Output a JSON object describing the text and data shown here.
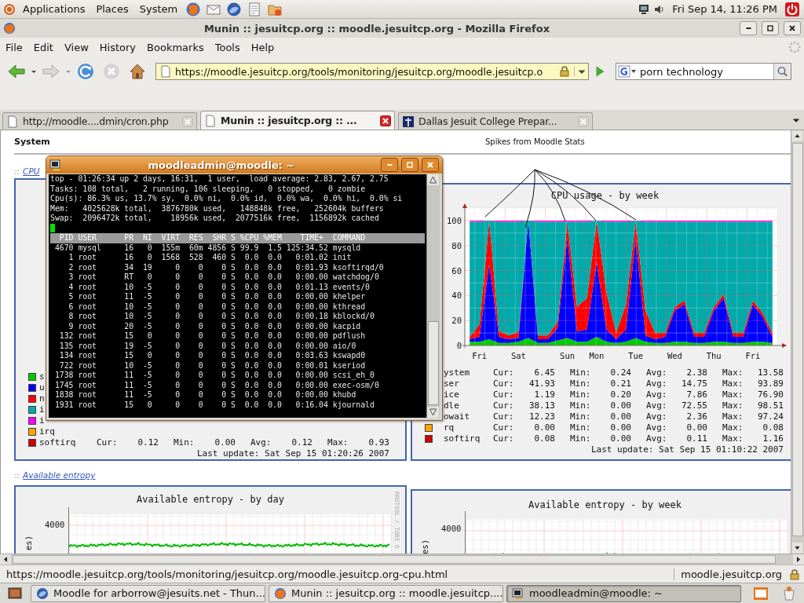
{
  "top_panel": {
    "menus": [
      "Applications",
      "Places",
      "System"
    ],
    "clock": "Fri Sep 14, 11:26 PM"
  },
  "window": {
    "title": "Munin :: jesuitcp.org :: moodle.jesuitcp.org - Mozilla Firefox"
  },
  "menu_bar": [
    "File",
    "Edit",
    "View",
    "History",
    "Bookmarks",
    "Tools",
    "Help"
  ],
  "address_bar": {
    "value": "https://moodle.jesuitcp.org/tools/monitoring/jesuitcp.org/moodle.jesuitcp.o"
  },
  "search": {
    "value": "porn technology"
  },
  "tabs": [
    {
      "label": "http://moodle....dmin/cron.php",
      "selected": false
    },
    {
      "label": "Munin :: jesuitcp.org :: ...",
      "selected": true
    },
    {
      "label": "Dallas Jesuit College Prepar...",
      "selected": false
    }
  ],
  "page": {
    "section_title": "System",
    "annotation": "Spikes from Moodle Stats",
    "cpu_link": {
      "prefix": "::",
      "label": "CPU"
    },
    "cpu_day_panel": {
      "legend": [
        {
          "label": "s",
          "color": "#00cc00"
        },
        {
          "label": "u",
          "color": "#0000ff"
        },
        {
          "label": "n",
          "color": "#ff0000"
        },
        {
          "label": "i",
          "color": "#00aaaa"
        },
        {
          "label": "i",
          "color": "#ff00ff"
        },
        {
          "label": "irq",
          "color": "#ffa500"
        },
        {
          "label": "softirq",
          "color": "#cc0000",
          "stats": [
            {
              "key": "Cur:",
              "value": "0.12"
            },
            {
              "key": "Min:",
              "value": "0.00"
            },
            {
              "key": "Avg:",
              "value": "0.12"
            },
            {
              "key": "Max:",
              "value": "0.93"
            }
          ]
        }
      ],
      "last_update": "Last update: Sat Sep 15 01:20:26 2007"
    },
    "cpu_week_panel": {
      "chart_data": {
        "type": "area",
        "title": "CPU usage - by week",
        "categories": [
          null,
          "Fri",
          null,
          null,
          null,
          "Sat",
          null,
          null,
          null,
          null,
          "Sun",
          null,
          null,
          "Mon",
          null,
          null,
          null,
          "Tue",
          null,
          null,
          null,
          "Wed",
          null,
          null,
          null,
          "Thu",
          null,
          null,
          null,
          "Fri",
          null,
          null
        ],
        "yticks": [
          0,
          20,
          40,
          60,
          80,
          100
        ],
        "ylim": [
          0,
          110
        ],
        "grid": true,
        "stacked": true,
        "series": [
          {
            "color": "#00cc00",
            "values": [
              3,
              3,
              5,
              2,
              2,
              3,
              6,
              2,
              2,
              4,
              6,
              3,
              3,
              7,
              3,
              2,
              3,
              6,
              3,
              2,
              2,
              3,
              3,
              2,
              2,
              3,
              3,
              2,
              2,
              3,
              3,
              2
            ]
          },
          {
            "color": "#0000ff",
            "values": [
              2,
              4,
              60,
              5,
              3,
              3,
              94,
              3,
              3,
              10,
              80,
              8,
              10,
              60,
              10,
              3,
              10,
              80,
              5,
              3,
              5,
              25,
              30,
              5,
              5,
              25,
              35,
              5,
              5,
              30,
              20,
              5
            ]
          },
          {
            "color": "#ff0000",
            "values": [
              2,
              10,
              35,
              5,
              3,
              5,
              0,
              3,
              3,
              5,
              13,
              20,
              25,
              33,
              30,
              5,
              20,
              14,
              20,
              5,
              3,
              3,
              3,
              3,
              3,
              3,
              3,
              3,
              3,
              3,
              3,
              3
            ]
          },
          {
            "color": "#00aaaa",
            "values": [
              92,
              82,
              0,
              87,
              91,
              88,
              0,
              91,
              91,
              80,
              0,
              68,
              61,
              0,
              56,
              89,
              66,
              0,
              71,
              89,
              89,
              68,
              63,
              89,
              89,
              68,
              58,
              89,
              89,
              63,
              73,
              89
            ]
          },
          {
            "color": "#ff00ff",
            "values": [
              1,
              1,
              0,
              1,
              1,
              1,
              0,
              1,
              1,
              1,
              1,
              1,
              1,
              0,
              1,
              1,
              1,
              0,
              1,
              1,
              1,
              1,
              1,
              1,
              1,
              1,
              1,
              1,
              1,
              1,
              1,
              1
            ]
          }
        ]
      },
      "legend": [
        {
          "label": "ystem",
          "stats": [
            {
              "key": "Cur:",
              "value": "6.45"
            },
            {
              "key": "Min:",
              "value": "0.24"
            },
            {
              "key": "Avg:",
              "value": "2.38"
            },
            {
              "key": "Max:",
              "value": "13.58"
            }
          ]
        },
        {
          "label": "ser",
          "stats": [
            {
              "key": "Cur:",
              "value": "41.93"
            },
            {
              "key": "Min:",
              "value": "0.21"
            },
            {
              "key": "Avg:",
              "value": "14.75"
            },
            {
              "key": "Max:",
              "value": "93.89"
            }
          ]
        },
        {
          "label": "ice",
          "stats": [
            {
              "key": "Cur:",
              "value": "1.19"
            },
            {
              "key": "Min:",
              "value": "0.20"
            },
            {
              "key": "Avg:",
              "value": "7.86"
            },
            {
              "key": "Max:",
              "value": "76.90"
            }
          ]
        },
        {
          "label": "dle",
          "stats": [
            {
              "key": "Cur:",
              "value": "38.13"
            },
            {
              "key": "Min:",
              "value": "0.00"
            },
            {
              "key": "Avg:",
              "value": "72.55"
            },
            {
              "key": "Max:",
              "value": "98.51"
            }
          ]
        },
        {
          "label": "owait",
          "stats": [
            {
              "key": "Cur:",
              "value": "12.23"
            },
            {
              "key": "Min:",
              "value": "0.00"
            },
            {
              "key": "Avg:",
              "value": "2.36"
            },
            {
              "key": "Max:",
              "value": "97.24"
            }
          ]
        },
        {
          "label": "rq",
          "color": "#ffa500",
          "stats": [
            {
              "key": "Cur:",
              "value": "0.00"
            },
            {
              "key": "Min:",
              "value": "0.00"
            },
            {
              "key": "Avg:",
              "value": "0.00"
            },
            {
              "key": "Max:",
              "value": "0.08"
            }
          ]
        },
        {
          "label": "softirq",
          "color": "#cc0000",
          "stats": [
            {
              "key": "Cur:",
              "value": "0.08"
            },
            {
              "key": "Min:",
              "value": "0.00"
            },
            {
              "key": "Avg:",
              "value": "0.11"
            },
            {
              "key": "Max:",
              "value": "1.16"
            }
          ]
        }
      ],
      "last_update": "Last update: Sat Sep 15 01:10:22 2007"
    },
    "entropy_link": {
      "prefix": "::",
      "label": "Available entropy"
    },
    "entropy_panels": [
      {
        "title": "Available entropy - by day",
        "ytick": "4000",
        "ylabel": "es)",
        "side_text": "RRDTOOL / TOBI O"
      },
      {
        "title": "Available entropy - by week",
        "ytick": "4000",
        "ylabel": "es)"
      }
    ]
  },
  "status_bar": {
    "url": "https://moodle.jesuitcp.org/tools/monitoring/jesuitcp.org/moodle.jesuitcp.org-cpu.html",
    "host": "moodle.jesuitcp.org"
  },
  "taskbar": [
    {
      "label": "Moodle for arborrow@jesuits.net - Thun...",
      "selected": false
    },
    {
      "label": "Munin :: jesuitcp.org :: moodle.jesuitcp....",
      "selected": false
    },
    {
      "label": "moodleadmin@moodle: ~",
      "selected": true
    }
  ],
  "terminal": {
    "title": "moodleadmin@moodle: ~",
    "summary": [
      "top - 01:26:34 up 2 days, 16:31,  1 user,  load average: 2.83, 2.67, 2.75",
      "Tasks: 108 total,   2 running, 106 sleeping,   0 stopped,   0 zombie",
      "Cpu(s): 86.3% us, 13.7% sy,  0.0% ni,  0.0% id,  0.0% wa,  0.0% hi,  0.0% si",
      "Mem:   4025628k total,  3876780k used,   148848k free,   252604k buffers",
      "Swap:  2096472k total,    18956k used,  2077516k free,  1156892k cached"
    ],
    "header": "  PID USER      PR  NI  VIRT  RES  SHR S %CPU %MEM    TIME+  COMMAND",
    "rows": [
      " 4670 mysql     16   0  155m  60m 4856 S 99.9  1.5 125:34.52 mysqld",
      "    1 root      16   0  1568  528  460 S  0.0  0.0   0:01.02 init",
      "    2 root      34  19     0    0    0 S  0.0  0.0   0:01.93 ksoftirqd/0",
      "    3 root      RT   0     0    0    0 S  0.0  0.0   0:00.00 watchdog/0",
      "    4 root      10  -5     0    0    0 S  0.0  0.0   0:01.13 events/0",
      "    5 root      11  -5     0    0    0 S  0.0  0.0   0:00.00 khelper",
      "    6 root      10  -5     0    0    0 S  0.0  0.0   0:00.00 kthread",
      "    8 root      10  -5     0    0    0 S  0.0  0.0   0:00.18 kblockd/0",
      "    9 root      20  -5     0    0    0 S  0.0  0.0   0:00.00 kacpid",
      "  132 root      15   0     0    0    0 S  0.0  0.0   0:00.00 pdflush",
      "  135 root      19  -5     0    0    0 S  0.0  0.0   0:00.00 aio/0",
      "  134 root      15   0     0    0    0 S  0.0  0.0   0:03.63 kswapd0",
      "  722 root      10  -5     0    0    0 S  0.0  0.0   0:00.01 kseriod",
      " 1738 root      11  -5     0    0    0 S  0.0  0.0   0:00.00 scsi_eh_0",
      " 1745 root      11  -5     0    0    0 S  0.0  0.0   0:00.00 exec-osm/0",
      " 1838 root      11  -5     0    0    0 S  0.0  0.0   0:00.00 khubd",
      " 1931 root      15   0     0    0    0 S  0.0  0.0   0:16.04 kjournald"
    ]
  }
}
